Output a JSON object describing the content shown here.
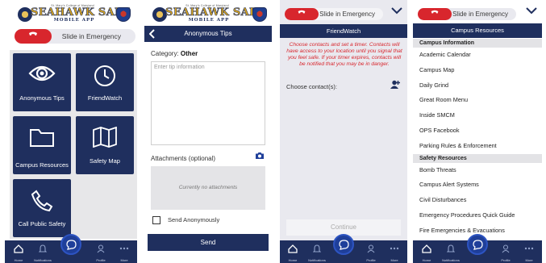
{
  "colors": {
    "navy": "#1f2f5e",
    "emergency_red": "#d8262d",
    "gold": "#d9a620",
    "grey_bg": "#e7e7e9"
  },
  "home": {
    "logo": {
      "top_text": "St. Mary's College of Maryland",
      "main": "SEAHAWK SAFE",
      "sub": "MOBILE APP"
    },
    "slider": {
      "label": "Slide in Emergency",
      "icon": "phone-icon"
    },
    "tiles": [
      {
        "label": "Anonymous Tips",
        "icon": "eye-icon"
      },
      {
        "label": "FriendWatch",
        "icon": "clock-icon"
      },
      {
        "label": "Campus Resources",
        "icon": "folder-icon"
      },
      {
        "label": "Safety Map",
        "icon": "map-icon"
      },
      {
        "label": "Call Public Safety",
        "icon": "phone-icon"
      }
    ]
  },
  "nav": {
    "items": [
      {
        "label": "Home",
        "icon": "home-icon"
      },
      {
        "label": "Notifications",
        "icon": "bell-icon"
      },
      {
        "label": "Chat",
        "icon": "chat-bubble-icon"
      },
      {
        "label": "Profile",
        "icon": "user-icon"
      },
      {
        "label": "More",
        "icon": "more-dots-icon"
      }
    ]
  },
  "tips": {
    "title": "Anonymous Tips",
    "category_label": "Category:",
    "category_value": "Other",
    "description_placeholder": "Enter tip information",
    "attachments_label": "Attachments (optional)",
    "no_attachments": "Currently no attachments",
    "anonymous_label": "Send Anonymously",
    "send_label": "Send"
  },
  "friendwatch": {
    "slider_label": "Slide in Emergency",
    "title": "FriendWatch",
    "info": "Choose contacts and set a timer. Contacts will have access to your location until you signal that you feel safe. If your timer expires, contacts will be notified that you may be in danger.",
    "contacts_label": "Choose contact(s):",
    "continue_label": "Continue"
  },
  "resources": {
    "slider_label": "Slide in Emergency",
    "title": "Campus Resources",
    "sections": [
      {
        "header": "Campus Information",
        "items": [
          "Academic Calendar",
          "Campus Map",
          "Daily Grind",
          "Great Room Menu",
          "Inside SMCM",
          "OPS Facebook",
          "Parking Rules & Enforcement"
        ]
      },
      {
        "header": "Safety Resources",
        "items": [
          "Bomb Threats",
          "Campus Alert Systems",
          "Civil Disturbances",
          "Emergency Procedures Quick Guide",
          "Fire Emergencies & Evacuations"
        ]
      }
    ]
  }
}
